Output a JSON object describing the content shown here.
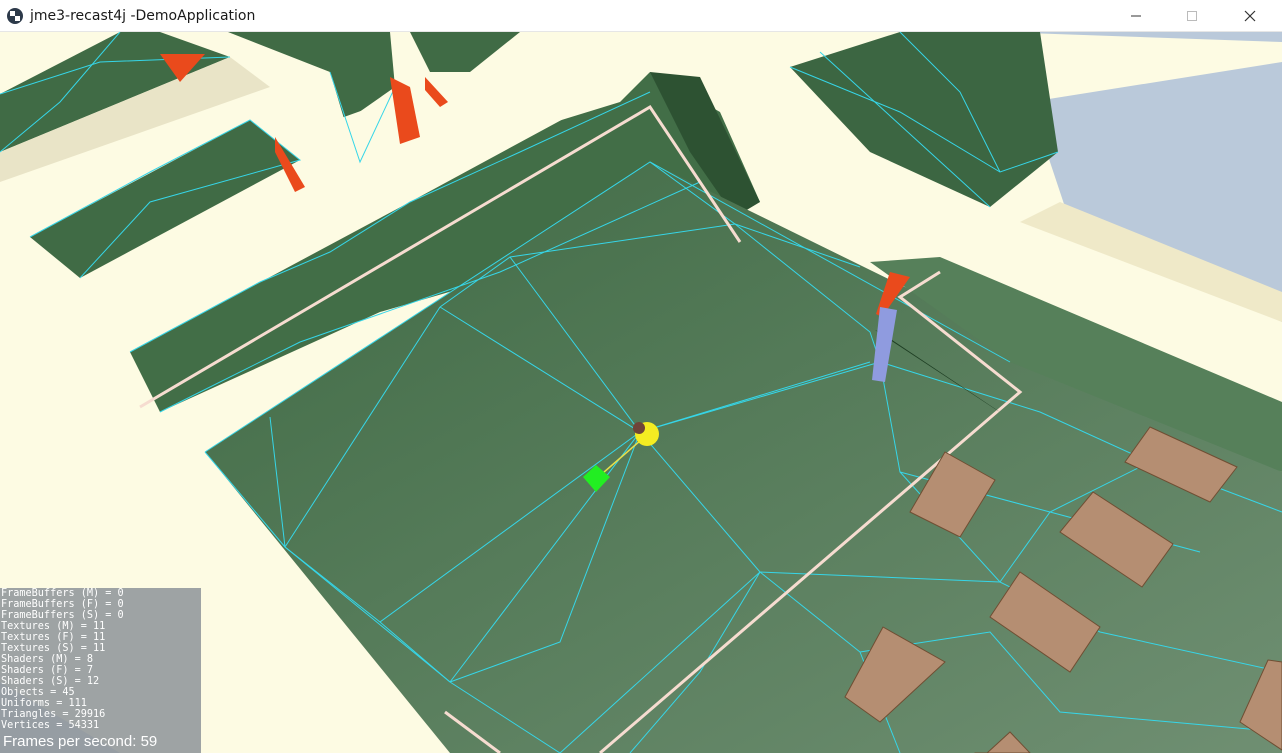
{
  "window": {
    "title": "jme3-recast4j -DemoApplication",
    "controls": [
      "minimize-icon",
      "maximize-icon",
      "close-icon"
    ]
  },
  "stats": {
    "lines": [
      "FrameBuffers (M) = 0",
      "FrameBuffers (F) = 0",
      "FrameBuffers (S) = 0",
      "Textures (M) = 11",
      "Textures (F) = 11",
      "Textures (S) = 11",
      "Shaders (M) = 8",
      "Shaders (F) = 7",
      "Shaders (S) = 12",
      "Objects = 45",
      "Uniforms = 111",
      "Triangles = 29916",
      "Vertices = 54331"
    ],
    "fps_label": "Frames per second:",
    "fps_value": "59"
  },
  "colors": {
    "sky": "#bac9da",
    "wall": "#fdfbe3",
    "floor": "#4c7550",
    "navmesh": "#36d6e8",
    "door": "#ea4a1c",
    "table": "#b58e72",
    "target": "#22ee22",
    "agent": "#f4ec22",
    "rail": "#f6dcd0"
  }
}
